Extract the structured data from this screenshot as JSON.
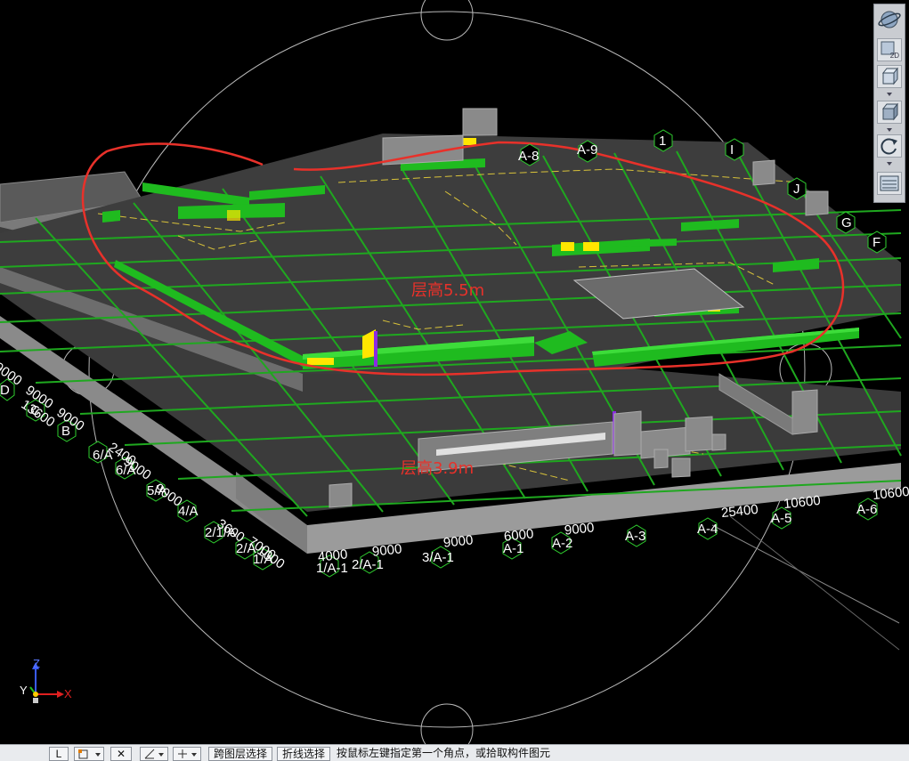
{
  "viewport": {
    "annotations": {
      "upper_floor": "层高5.5m",
      "lower_floor": "层高3.9m"
    },
    "axis_bubbles": [
      "A-8",
      "A-9",
      "1",
      "I",
      "J",
      "G",
      "F",
      "D",
      "C",
      "B",
      "6/A",
      "6/A",
      "5/A",
      "4/A",
      "2/1/A",
      "2/A",
      "1/A",
      "1/A-1",
      "2/A-1",
      "3/A-1",
      "A-1",
      "A-2",
      "A-3",
      "A-4",
      "A-5",
      "A-6"
    ],
    "dimension_labels": [
      "9000",
      "9000",
      "9000",
      "9000",
      "9000",
      "4000",
      "6000",
      "9000",
      "9000",
      "9000",
      "10600",
      "10600",
      "25400",
      "2400",
      "13600",
      "3600",
      "7000",
      "1000"
    ],
    "triad": {
      "x": "X",
      "y": "Y",
      "z": "Z"
    }
  },
  "view_toolbar": {
    "buttons": [
      "orbit",
      "2D",
      "3d-box",
      "3d-view",
      "rotate",
      "display-settings"
    ],
    "two_d_label": "2D"
  },
  "status_bar": {
    "btn_l": "L",
    "cross_layer_select": "跨图层选择",
    "polyline_select": "折线选择",
    "prompt": "按鼠标左键指定第一个角点，或拾取构件图元"
  },
  "colors": {
    "background": "#000000",
    "slab_top": "#3c3c3c",
    "slab_side": "#777777",
    "beam": "#1fbb1f",
    "beam_bright": "#3ddc3a",
    "annotation": "#e8312a",
    "highlight": "#ffe600",
    "purple": "#8a2be2"
  }
}
